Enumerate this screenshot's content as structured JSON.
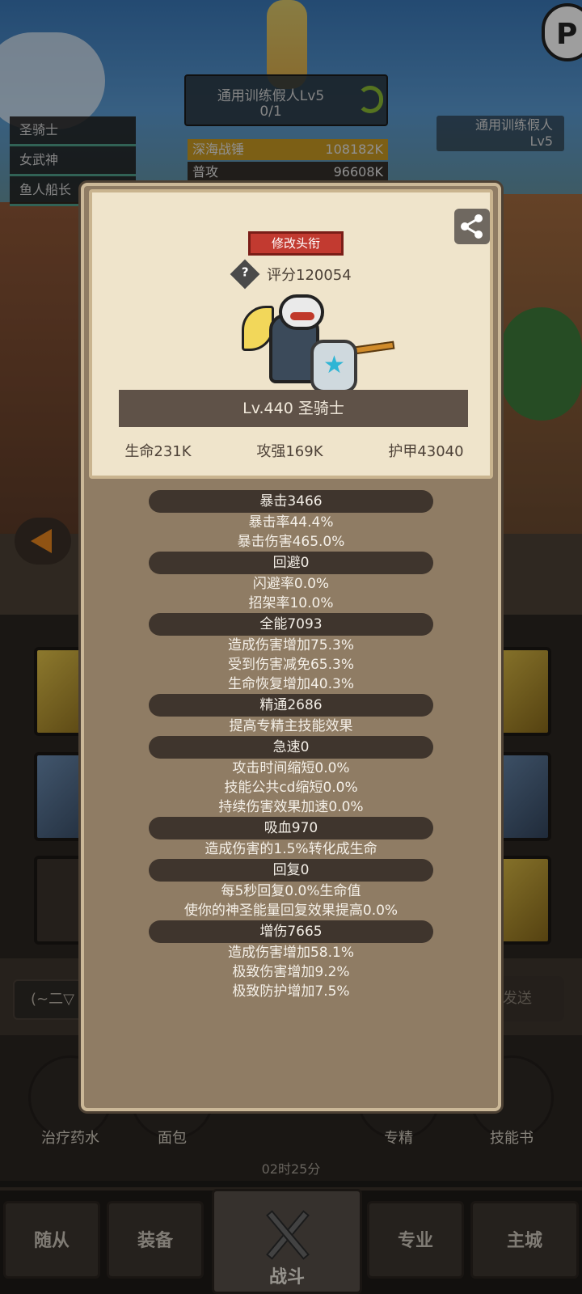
{
  "background": {
    "target_name": "通用训练假人Lv5",
    "target_progress": "0/1",
    "target_right_name": "通用训练假人",
    "target_right_level": "Lv5",
    "team": [
      "圣骑士",
      "女武神",
      "鱼人船长"
    ],
    "damage_rows": [
      {
        "label": "深海战锤",
        "value": "108182K"
      },
      {
        "label": "普攻",
        "value": "96608K"
      }
    ],
    "dropdown_label": "(~二▽",
    "send_label": "发送",
    "consumables": [
      "治疗药水",
      "面包",
      "专精",
      "技能书"
    ],
    "timer": "02时25分",
    "nav": [
      "随从",
      "装备",
      "战斗",
      "专业",
      "主城"
    ],
    "corner_logo": "P"
  },
  "card": {
    "title_button": "修改头衔",
    "score_label": "评分120054",
    "help_icon": "?",
    "hero_name": "Lv.440 圣骑士",
    "main_stats": [
      "生命231K",
      "攻强169K",
      "护甲43040"
    ]
  },
  "stats": [
    {
      "header": "暴击3466",
      "lines": [
        "暴击率44.4%",
        "暴击伤害465.0%"
      ]
    },
    {
      "header": "回避0",
      "lines": [
        "闪避率0.0%",
        "招架率10.0%"
      ]
    },
    {
      "header": "全能7093",
      "lines": [
        "造成伤害增加75.3%",
        "受到伤害减免65.3%",
        "生命恢复增加40.3%"
      ]
    },
    {
      "header": "精通2686",
      "lines": [
        "提高专精主技能效果"
      ]
    },
    {
      "header": "急速0",
      "lines": [
        "攻击时间缩短0.0%",
        "技能公共cd缩短0.0%",
        "持续伤害效果加速0.0%"
      ]
    },
    {
      "header": "吸血970",
      "lines": [
        "造成伤害的1.5%转化成生命"
      ]
    },
    {
      "header": "回复0",
      "lines": [
        "每5秒回复0.0%生命值",
        "使你的神圣能量回复效果提高0.0%"
      ]
    },
    {
      "header": "增伤7665",
      "lines": [
        "造成伤害增加58.1%",
        "极致伤害增加9.2%",
        "极致防护增加7.5%"
      ]
    }
  ]
}
